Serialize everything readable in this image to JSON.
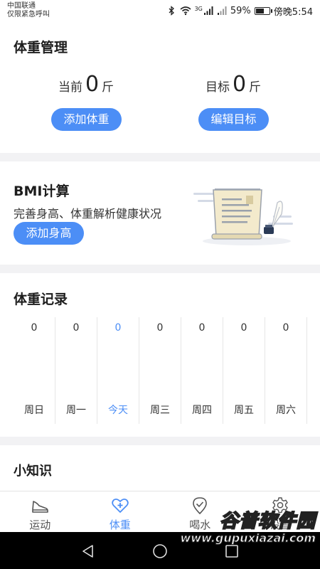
{
  "status_bar": {
    "carrier": "中国联通",
    "carrier_note": "仅限紧急呼叫",
    "network": "3G",
    "battery": "59%",
    "time": "傍晚5:54"
  },
  "weight_mgmt": {
    "title": "体重管理",
    "current_label": "当前",
    "current_value": "0",
    "current_unit": "斤",
    "target_label": "目标",
    "target_value": "0",
    "target_unit": "斤",
    "add_weight_button": "添加体重",
    "edit_target_button": "编辑目标"
  },
  "bmi": {
    "title": "BMI计算",
    "subtitle": "完善身高、体重解析健康状况",
    "add_height_button": "添加身高"
  },
  "records": {
    "title": "体重记录",
    "days": [
      {
        "label": "周日",
        "value": "0"
      },
      {
        "label": "周一",
        "value": "0"
      },
      {
        "label": "今天",
        "value": "0"
      },
      {
        "label": "周三",
        "value": "0"
      },
      {
        "label": "周四",
        "value": "0"
      },
      {
        "label": "周五",
        "value": "0"
      },
      {
        "label": "周六",
        "value": "0"
      }
    ]
  },
  "tips": {
    "title": "小知识"
  },
  "tabbar": {
    "items": [
      {
        "label": "运动",
        "icon": "shoe-icon"
      },
      {
        "label": "体重",
        "icon": "heart-plus-icon"
      },
      {
        "label": "喝水",
        "icon": "check-pin-icon"
      },
      {
        "label": "设置",
        "icon": "gear-icon"
      }
    ]
  },
  "watermark": {
    "text": "谷普软件园",
    "url": "www.gupuxiazai.com"
  },
  "colors": {
    "accent": "#4c8ef6",
    "background": "#f2f2f4"
  }
}
